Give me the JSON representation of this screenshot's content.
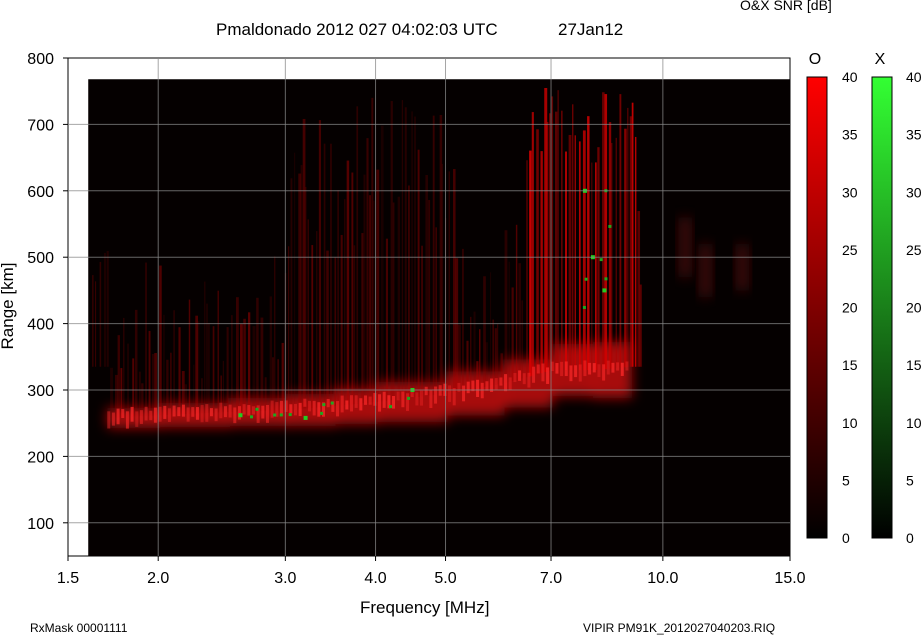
{
  "header": {
    "title": "Pmaldonado 2012 027 04:02:03 UTC",
    "date": "27Jan12",
    "snr_caption": "O&X SNR [dB]"
  },
  "footer": {
    "left": "RxMask 00001111",
    "right": "VIPIR  PM91K_2012027040203.RIQ"
  },
  "chart_data": {
    "type": "heatmap",
    "title": "Pmaldonado 2012 027 04:02:03 UTC",
    "xlabel": "Frequency [MHz]",
    "ylabel": "Range [km]",
    "x_scale": "log",
    "xlim": [
      1.5,
      15.0
    ],
    "ylim": [
      50,
      800
    ],
    "x_ticks": [
      1.5,
      2.0,
      3.0,
      4.0,
      5.0,
      7.0,
      10.0,
      15.0
    ],
    "x_tick_labels": [
      "1.5",
      "2.0",
      "3.0",
      "4.0",
      "5.0",
      "7.0",
      "10.0",
      "15.0"
    ],
    "y_ticks": [
      100,
      200,
      300,
      400,
      500,
      600,
      700,
      800
    ],
    "y_tick_labels": [
      "100",
      "200",
      "300",
      "400",
      "500",
      "600",
      "700",
      "800"
    ],
    "grid": true,
    "colorbars": [
      {
        "name": "O",
        "range": [
          0,
          40
        ],
        "ticks": [
          0,
          5,
          10,
          15,
          20,
          25,
          30,
          35,
          40
        ],
        "color_max": "#ff0000"
      },
      {
        "name": "X",
        "range": [
          0,
          40
        ],
        "ticks": [
          0,
          5,
          10,
          15,
          20,
          25,
          30,
          35,
          40
        ],
        "color_max": "#33ff33"
      }
    ],
    "o_trace": [
      {
        "freq": 1.7,
        "range": 258
      },
      {
        "freq": 2.0,
        "range": 262
      },
      {
        "freq": 2.5,
        "range": 267
      },
      {
        "freq": 3.0,
        "range": 270
      },
      {
        "freq": 3.5,
        "range": 276
      },
      {
        "freq": 4.0,
        "range": 282
      },
      {
        "freq": 5.0,
        "range": 295
      },
      {
        "freq": 6.0,
        "range": 310
      },
      {
        "freq": 7.0,
        "range": 330
      },
      {
        "freq": 8.0,
        "range": 330
      },
      {
        "freq": 9.0,
        "range": 335
      }
    ],
    "x_points": [
      {
        "freq": 2.6,
        "range": 262
      },
      {
        "freq": 3.2,
        "range": 258
      },
      {
        "freq": 4.5,
        "range": 300
      },
      {
        "freq": 7.8,
        "range": 600
      },
      {
        "freq": 8.0,
        "range": 500
      },
      {
        "freq": 8.3,
        "range": 450
      }
    ]
  }
}
